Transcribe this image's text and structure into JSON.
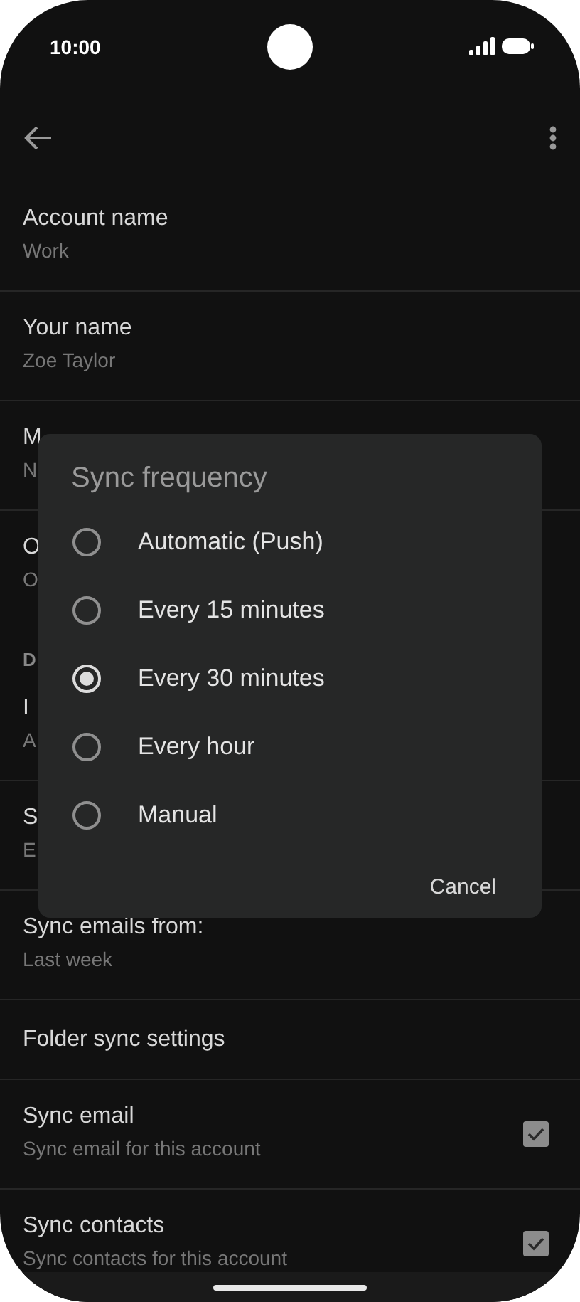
{
  "status_bar": {
    "time": "10:00"
  },
  "settings": [
    {
      "kind": "item",
      "title": "Account name",
      "subtitle": "Work"
    },
    {
      "kind": "item",
      "title": "Your name",
      "subtitle": "Zoe Taylor"
    },
    {
      "kind": "item",
      "title": "M",
      "subtitle": "N"
    },
    {
      "kind": "item",
      "title": "O",
      "subtitle": "O"
    },
    {
      "kind": "header",
      "title": "D"
    },
    {
      "kind": "item",
      "title": "I",
      "subtitle": "A"
    },
    {
      "kind": "item",
      "title": "S",
      "subtitle": "E"
    },
    {
      "kind": "item",
      "title": "Sync emails from:",
      "subtitle": "Last week"
    },
    {
      "kind": "item",
      "title": "Folder sync settings"
    },
    {
      "kind": "checkbox",
      "title": "Sync email",
      "subtitle": "Sync email for this account",
      "checked": true
    },
    {
      "kind": "checkbox",
      "title": "Sync contacts",
      "subtitle": "Sync contacts for this account",
      "checked": true
    }
  ],
  "dialog": {
    "title": "Sync frequency",
    "options": [
      {
        "label": "Automatic (Push)",
        "selected": false
      },
      {
        "label": "Every 15 minutes",
        "selected": false
      },
      {
        "label": "Every 30 minutes",
        "selected": true
      },
      {
        "label": "Every hour",
        "selected": false
      },
      {
        "label": "Manual",
        "selected": false
      }
    ],
    "button": "Cancel"
  }
}
